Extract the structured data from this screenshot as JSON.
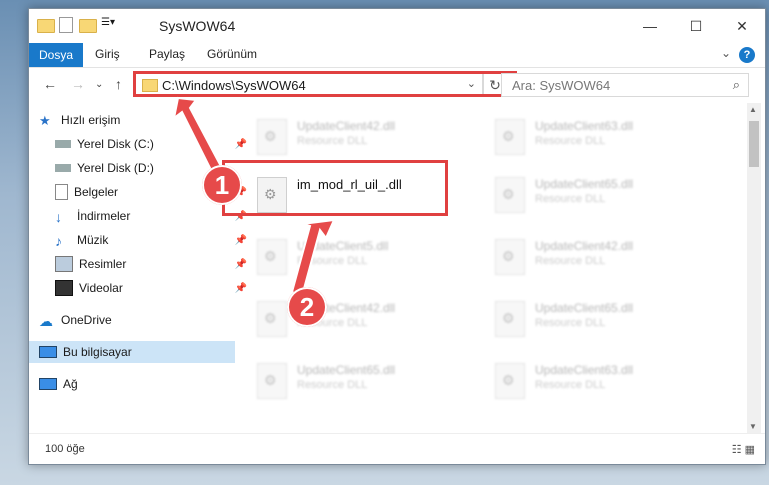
{
  "window": {
    "title": "SysWOW64",
    "controls": {
      "minimize": "—",
      "maximize": "☐",
      "close": "✕"
    }
  },
  "ribbon": {
    "tabs": [
      "Dosya",
      "Giriş",
      "Paylaş",
      "Görünüm"
    ],
    "help_label": "?",
    "collapse_label": "⌄"
  },
  "nav": {
    "back": "←",
    "forward": "→",
    "dropdown": "⌄",
    "up": "↑",
    "address_value": "C:\\Windows\\SysWOW64",
    "address_dropdown": "⌄",
    "refresh": "↻",
    "search_placeholder": "Ara: SysWOW64",
    "search_icon": "⌕"
  },
  "sidebar": {
    "items": [
      {
        "label": "Hızlı erişim",
        "icon": "star-icon",
        "pinned": false
      },
      {
        "label": "Yerel Disk (C:)",
        "icon": "drive-icon",
        "pinned": true
      },
      {
        "label": "Yerel Disk (D:)",
        "icon": "drive-icon",
        "pinned": false
      },
      {
        "label": "Belgeler",
        "icon": "documents-icon",
        "pinned": true
      },
      {
        "label": "İndirmeler",
        "icon": "downloads-icon",
        "pinned": true
      },
      {
        "label": "Müzik",
        "icon": "music-icon",
        "pinned": true
      },
      {
        "label": "Resimler",
        "icon": "pictures-icon",
        "pinned": true
      },
      {
        "label": "Videolar",
        "icon": "videos-icon",
        "pinned": true
      },
      {
        "label": "OneDrive",
        "icon": "onedrive-icon",
        "pinned": false
      },
      {
        "label": "Bu bilgisayar",
        "icon": "computer-icon",
        "pinned": false,
        "selected": true
      },
      {
        "label": "Ağ",
        "icon": "network-icon",
        "pinned": false
      }
    ],
    "pin_glyph": "📌"
  },
  "files": [
    {
      "name": "UpdateClient42.dll",
      "type": "Resource DLL",
      "blurred": true
    },
    {
      "name": "UpdateClient63.dll",
      "type": "Resource DLL",
      "blurred": true
    },
    {
      "name": "im_mod_rl_uil_.dll",
      "type": "",
      "blurred": false
    },
    {
      "name": "UpdateClient65.dll",
      "type": "Resource DLL",
      "blurred": true
    },
    {
      "name": "UpdateClient5.dll",
      "type": "Resource DLL",
      "blurred": true
    },
    {
      "name": "UpdateClient42.dll",
      "type": "Resource DLL",
      "blurred": true
    },
    {
      "name": "UpdateClient42.dll",
      "type": "Resource DLL",
      "blurred": true
    },
    {
      "name": "UpdateClient65.dll",
      "type": "Resource DLL",
      "blurred": true
    },
    {
      "name": "UpdateClient65.dll",
      "type": "Resource DLL",
      "blurred": true
    },
    {
      "name": "UpdateClient63.dll",
      "type": "Resource DLL",
      "blurred": true
    }
  ],
  "status": {
    "item_count": "100 öğe",
    "views": "☷ ▦"
  },
  "annotations": {
    "step1": "1",
    "step2": "2"
  },
  "colors": {
    "accent": "#1979ca",
    "highlight": "#e04040",
    "badge": "#e64a4a"
  }
}
